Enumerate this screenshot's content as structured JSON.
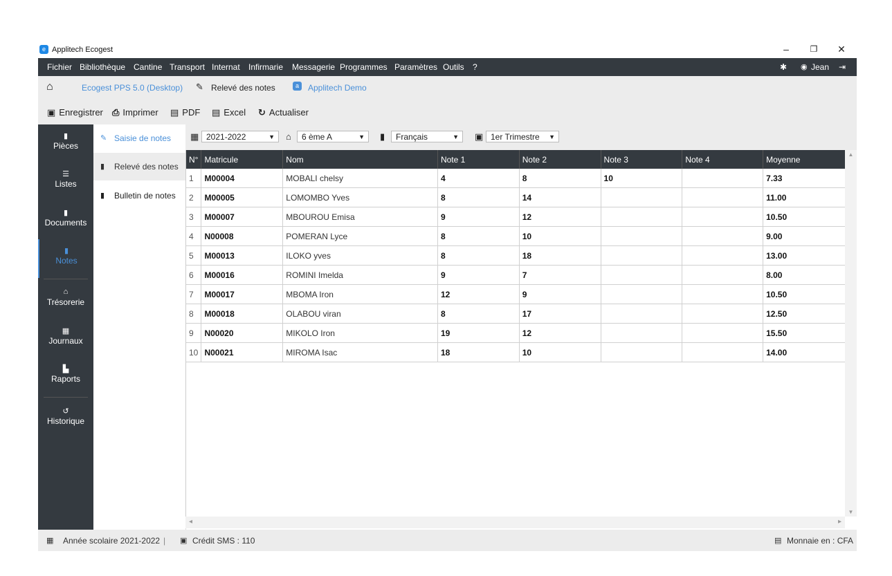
{
  "window": {
    "title": "Applitech Ecogest",
    "controls": {
      "minimize": "–",
      "maximize": "❐",
      "close": "✕"
    }
  },
  "menu": {
    "items": [
      "Fichier",
      "Bibliothèque",
      "Cantine",
      "Transport",
      "Internat",
      "Infirmarie",
      "Messagerie",
      "Programmes",
      "Paramètres",
      "Outils",
      "?"
    ],
    "user": "Jean",
    "icons": [
      "bug-icon",
      "user-icon",
      "logout-icon"
    ]
  },
  "breadcrumb": {
    "home_icon": "home-icon",
    "app": "Ecogest PPS 5.0 (Desktop)",
    "page": "Relevé des notes",
    "company": "Applitech Demo"
  },
  "actions": {
    "save": "Enregistrer",
    "print": "Imprimer",
    "pdf": "PDF",
    "excel": "Excel",
    "refresh": "Actualiser"
  },
  "sidebar": {
    "items": [
      {
        "label": "Pièces",
        "icon": "file-icon"
      },
      {
        "label": "Listes",
        "icon": "list-icon"
      },
      {
        "label": "Documents",
        "icon": "document-icon"
      },
      {
        "label": "Notes",
        "icon": "notes-icon"
      },
      {
        "label": "Trésorerie",
        "icon": "treasury-icon"
      },
      {
        "label": "Journaux",
        "icon": "journal-icon"
      },
      {
        "label": "Raports",
        "icon": "chart-icon"
      },
      {
        "label": "Historique",
        "icon": "history-icon"
      }
    ],
    "active": "Notes"
  },
  "subnav": {
    "items": [
      {
        "label": "Saisie de notes",
        "icon": "edit-icon"
      },
      {
        "label": "Relevé des notes",
        "icon": "file-icon"
      },
      {
        "label": "Bulletin de notes",
        "icon": "file-icon"
      }
    ]
  },
  "filters": {
    "year": "2021-2022",
    "class": "6 ème A",
    "subject": "Français",
    "term": "1er Trimestre"
  },
  "table": {
    "headers": [
      "N°",
      "Matricule",
      "Nom",
      "Note 1",
      "Note 2",
      "Note 3",
      "Note 4",
      "Moyenne"
    ],
    "rows": [
      [
        "1",
        "M00004",
        "MOBALI chelsy",
        "4",
        "8",
        "10",
        "",
        "7.33"
      ],
      [
        "2",
        "M00005",
        "LOMOMBO Yves",
        "8",
        "14",
        "",
        "",
        "11.00"
      ],
      [
        "3",
        "M00007",
        "MBOUROU Emisa",
        "9",
        "12",
        "",
        "",
        "10.50"
      ],
      [
        "4",
        "N00008",
        "POMERAN Lyce",
        "8",
        "10",
        "",
        "",
        "9.00"
      ],
      [
        "5",
        "M00013",
        "ILOKO yves",
        "8",
        "18",
        "",
        "",
        "13.00"
      ],
      [
        "6",
        "M00016",
        "ROMINI Imelda",
        "9",
        "7",
        "",
        "",
        "8.00"
      ],
      [
        "7",
        "M00017",
        "MBOMA Iron",
        "12",
        "9",
        "",
        "",
        "10.50"
      ],
      [
        "8",
        "M00018",
        "OLABOU viran",
        "8",
        "17",
        "",
        "",
        "12.50"
      ],
      [
        "9",
        "N00020",
        "MIKOLO Iron",
        "19",
        "12",
        "",
        "",
        "15.50"
      ],
      [
        "10",
        "N00021",
        "MIROMA Isac",
        "18",
        "10",
        "",
        "",
        "14.00"
      ]
    ]
  },
  "status": {
    "school_year": "Année scolaire 2021-2022",
    "separator": "|",
    "sms": "Crédit SMS : 110",
    "currency": "Monnaie en : CFA"
  },
  "colors": {
    "dark": "#343a40",
    "accent": "#4a90d9",
    "toolbar": "#ececec"
  }
}
